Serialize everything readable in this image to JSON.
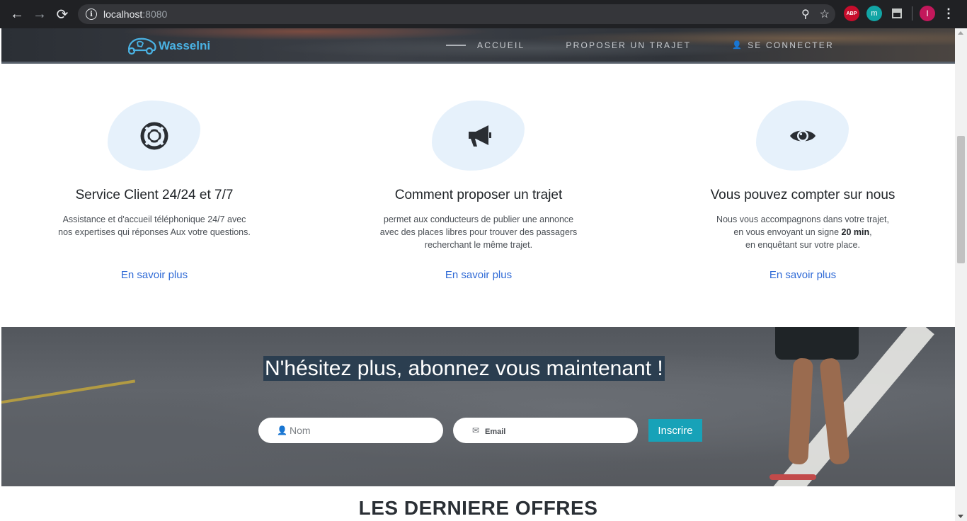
{
  "browser": {
    "url_host": "localhost",
    "url_port": ":8080",
    "avatar_letter": "I",
    "ext_abp": "ABP",
    "ext_m": "m",
    "back_glyph": "←",
    "forward_glyph": "→",
    "reload_glyph": "⟳",
    "info_glyph": "i",
    "zoom_glyph": "⚲",
    "star_glyph": "☆",
    "menu_glyph": "⋮"
  },
  "site": {
    "logo_text": "Wasselni",
    "nav": {
      "accueil": "Accueil",
      "proposer": "Proposer un trajet",
      "connecter": "Se connecter",
      "user_glyph": "👤"
    }
  },
  "features": [
    {
      "icon": "lifebuoy-icon",
      "title": "Service Client 24/24 et 7/7",
      "line1": "Assistance et d'accueil téléphonique 24/7 avec",
      "line2": "nos expertises qui réponses Aux votre questions.",
      "link": "En savoir plus"
    },
    {
      "icon": "megaphone-icon",
      "title": "Comment proposer un trajet",
      "line1": "permet aux conducteurs de publier une annonce",
      "line2": "avec des places libres pour trouver des passagers",
      "line3": "recherchant le même trajet.",
      "link": "En savoir plus"
    },
    {
      "icon": "eye-icon",
      "title": "Vous pouvez compter sur nous",
      "line1": "Nous vous accompagnons dans votre trajet,",
      "line2a": "en vous envoyant un signe ",
      "line2b": "20 min",
      "line2c": ",",
      "line3": "en enquêtant sur votre place.",
      "link": "En savoir plus"
    }
  ],
  "subscribe": {
    "heading": "N'hésitez plus, abonnez vous maintenant !",
    "name_placeholder": "Nom",
    "email_placeholder": "Email",
    "button": "Inscrire",
    "user_glyph": "👤",
    "mail_glyph": "✉"
  },
  "offers": {
    "title": "LES DERNIERE OFFRES"
  },
  "colors": {
    "accent": "#17a2b8",
    "link": "#2f6ad6",
    "logo": "#4ab2e3",
    "icon_blob": "#e6f1fb"
  }
}
